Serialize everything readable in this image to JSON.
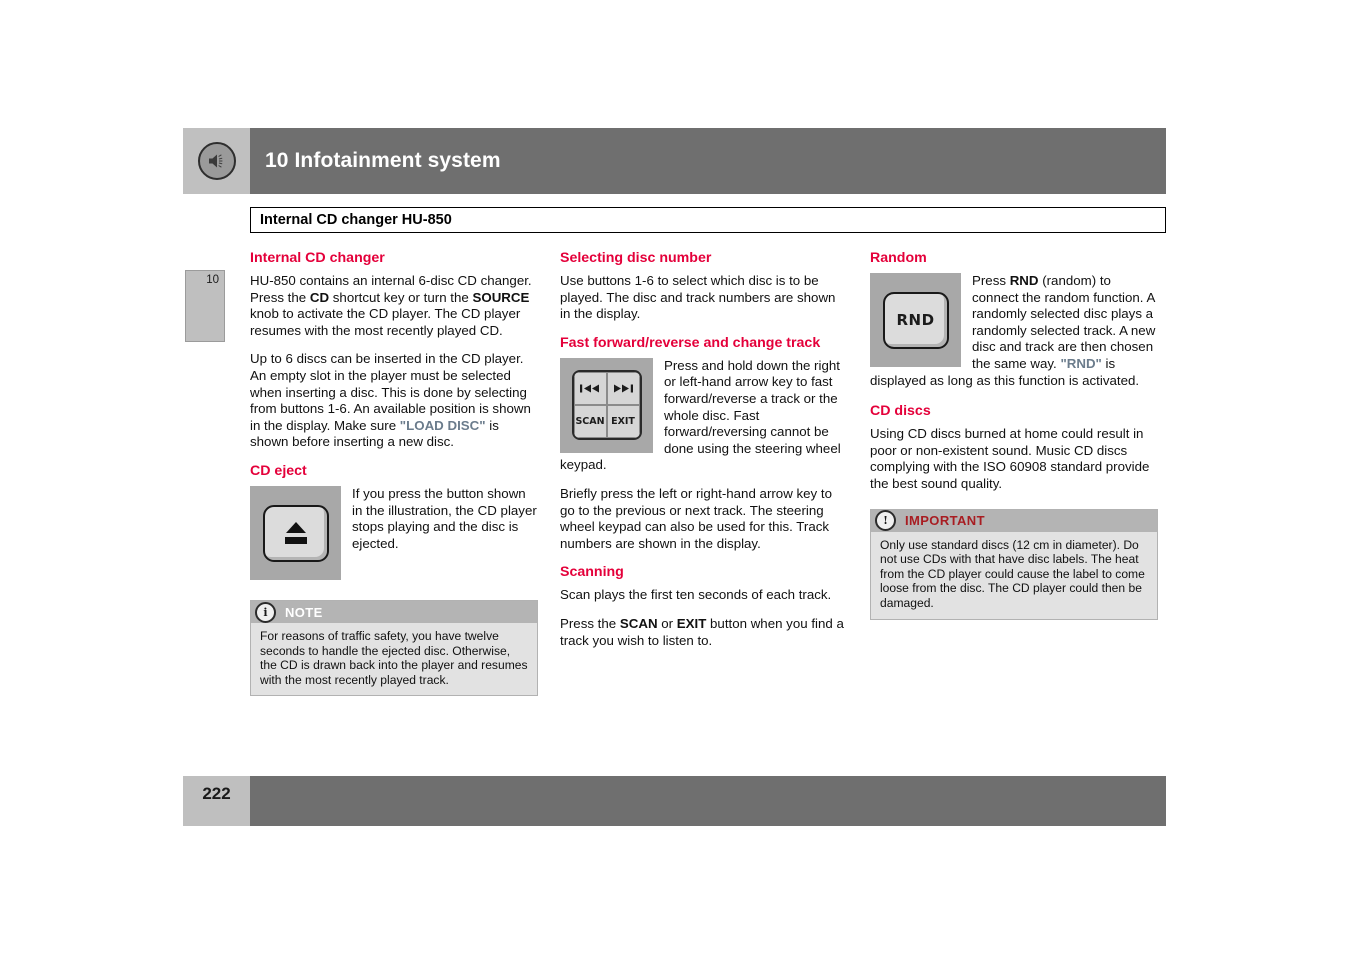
{
  "header": {
    "chapter_title": "10 Infotainment system",
    "icon": "speaker-icon",
    "section_title": "Internal CD changer HU-850",
    "chapter_tab_number": "10"
  },
  "footer": {
    "page_number": "222"
  },
  "colors": {
    "heading_red": "#e4003a",
    "important_red": "#a81d22",
    "display_text": "#6b7c8c",
    "header_bar": "#6f6f6f",
    "tab_gray": "#bfbfbf"
  },
  "columns": {
    "left": {
      "heading_internal_cd_changer": "Internal CD changer",
      "para1": {
        "t1": "HU-850 contains an internal 6-disc CD changer. Press the ",
        "b1": "CD",
        "t2": " shortcut key or turn the ",
        "b2": "SOURCE",
        "t3": " knob to activate the CD player. The CD player resumes with the most recently played CD."
      },
      "para2": {
        "t1": "Up to 6 discs can be inserted in the CD player. An empty slot in the player must be selected when inserting a disc. This is done by selecting from buttons 1-6. An available position is shown in the display. Make sure ",
        "d1": "\"LOAD DISC\"",
        "t2": " is shown before inserting a new disc."
      },
      "heading_cd_eject": "CD eject",
      "eject_figure": "cd-eject-button-illustration",
      "eject_text": "If you press the button shown in the illustration, the CD player stops playing and the disc is ejected.",
      "note": {
        "badge": "i",
        "label": "NOTE",
        "body": "For reasons of traffic safety, you have twelve seconds to handle the ejected disc. Otherwise, the CD is drawn back into the player and resumes with the most recently played track."
      }
    },
    "middle": {
      "heading_selecting_disc_number": "Selecting disc number",
      "para1": "Use buttons 1-6 to select which disc is to be played. The disc and track numbers are shown in the display.",
      "heading_fast_forward": "Fast forward/reverse and change track",
      "keypad": {
        "key_prev": "prev-track-icon",
        "key_next": "next-track-icon",
        "key_scan": "SCAN",
        "key_exit": "EXIT"
      },
      "keypad_text": "Press and hold down the right or left-hand arrow key to fast forward/reverse a track or the whole disc. Fast forward/reversing cannot be done using the steering wheel keypad.",
      "para2": "Briefly press the left or right-hand arrow key to go to the previous or next track. The steering wheel keypad can also be used for this. Track numbers are shown in the display.",
      "heading_scanning": "Scanning",
      "para3": "Scan plays the first ten seconds of each track.",
      "para4": {
        "t1": "Press the ",
        "b1": "SCAN",
        "t2": " or ",
        "b2": "EXIT",
        "t3": " button when you find a track you wish to listen to."
      }
    },
    "right": {
      "heading_random": "Random",
      "rnd_figure_label": "RND",
      "random_text": {
        "t1": "Press ",
        "b1": "RND",
        "t2": " (random) to connect the random function. A randomly selected disc plays a randomly selected track. A new disc and track are then chosen the same way. ",
        "d1": "\"RND\"",
        "t3": " is displayed as long as this function is activated."
      },
      "heading_cd_discs": "CD discs",
      "cd_discs_text": "Using CD discs burned at home could result in poor or non-existent sound. Music CD discs complying with the ISO 60908 standard provide the best sound quality.",
      "important": {
        "badge": "!",
        "label": "IMPORTANT",
        "body": "Only use standard discs (12 cm in diameter). Do not use CDs with that have disc labels. The heat from the CD player could cause the label to come loose from the disc. The CD player could then be damaged."
      }
    }
  }
}
